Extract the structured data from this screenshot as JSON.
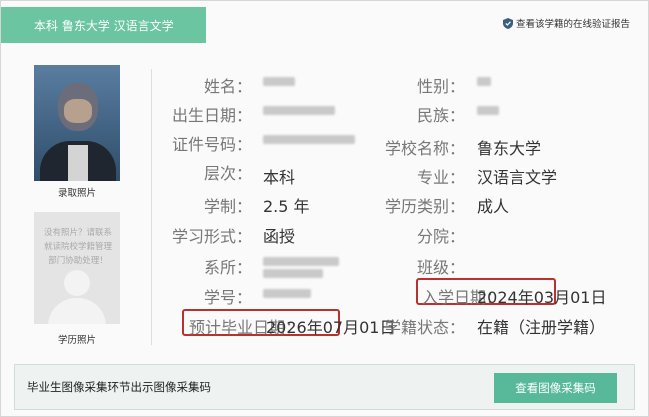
{
  "header": {
    "tab_title": "本科 鲁东大学 汉语言文学",
    "verify_link": "查看该学籍的在线验证报告"
  },
  "photos": {
    "enroll_caption": "录取照片",
    "grad_caption": "学历照片",
    "grad_placeholder_text": "没有照片？请联系就读院校学籍管理部门协助处理！"
  },
  "info": {
    "name_label": "姓名：",
    "gender_label": "性别：",
    "birth_label": "出生日期：",
    "ethnicity_label": "民族：",
    "id_label": "证件号码：",
    "school_label": "学校名称：",
    "school_value": "鲁东大学",
    "level_label": "层次：",
    "level_value": "本科",
    "major_label": "专业：",
    "major_value": "汉语言文学",
    "duration_label": "学制：",
    "duration_value": "2.5 年",
    "edu_type_label": "学历类别：",
    "edu_type_value": "成人",
    "study_form_label": "学习形式：",
    "study_form_value": "函授",
    "branch_label": "分院：",
    "dept_label": "系所：",
    "class_label": "班级：",
    "student_no_label": "学号：",
    "enroll_date_label": "入学日期：",
    "enroll_date_value": "2024年03月01日",
    "grad_date_label": "预计毕业日期：",
    "grad_date_value": "2026年07月01日",
    "status_label": "学籍状态：",
    "status_value": "在籍（注册学籍）"
  },
  "footer": {
    "text": "毕业生图像采集环节出示图像采集码",
    "button_label": "查看图像采集码"
  },
  "colors": {
    "accent": "#6bc5a0",
    "button": "#57b89a",
    "highlight": "#b8312f"
  }
}
